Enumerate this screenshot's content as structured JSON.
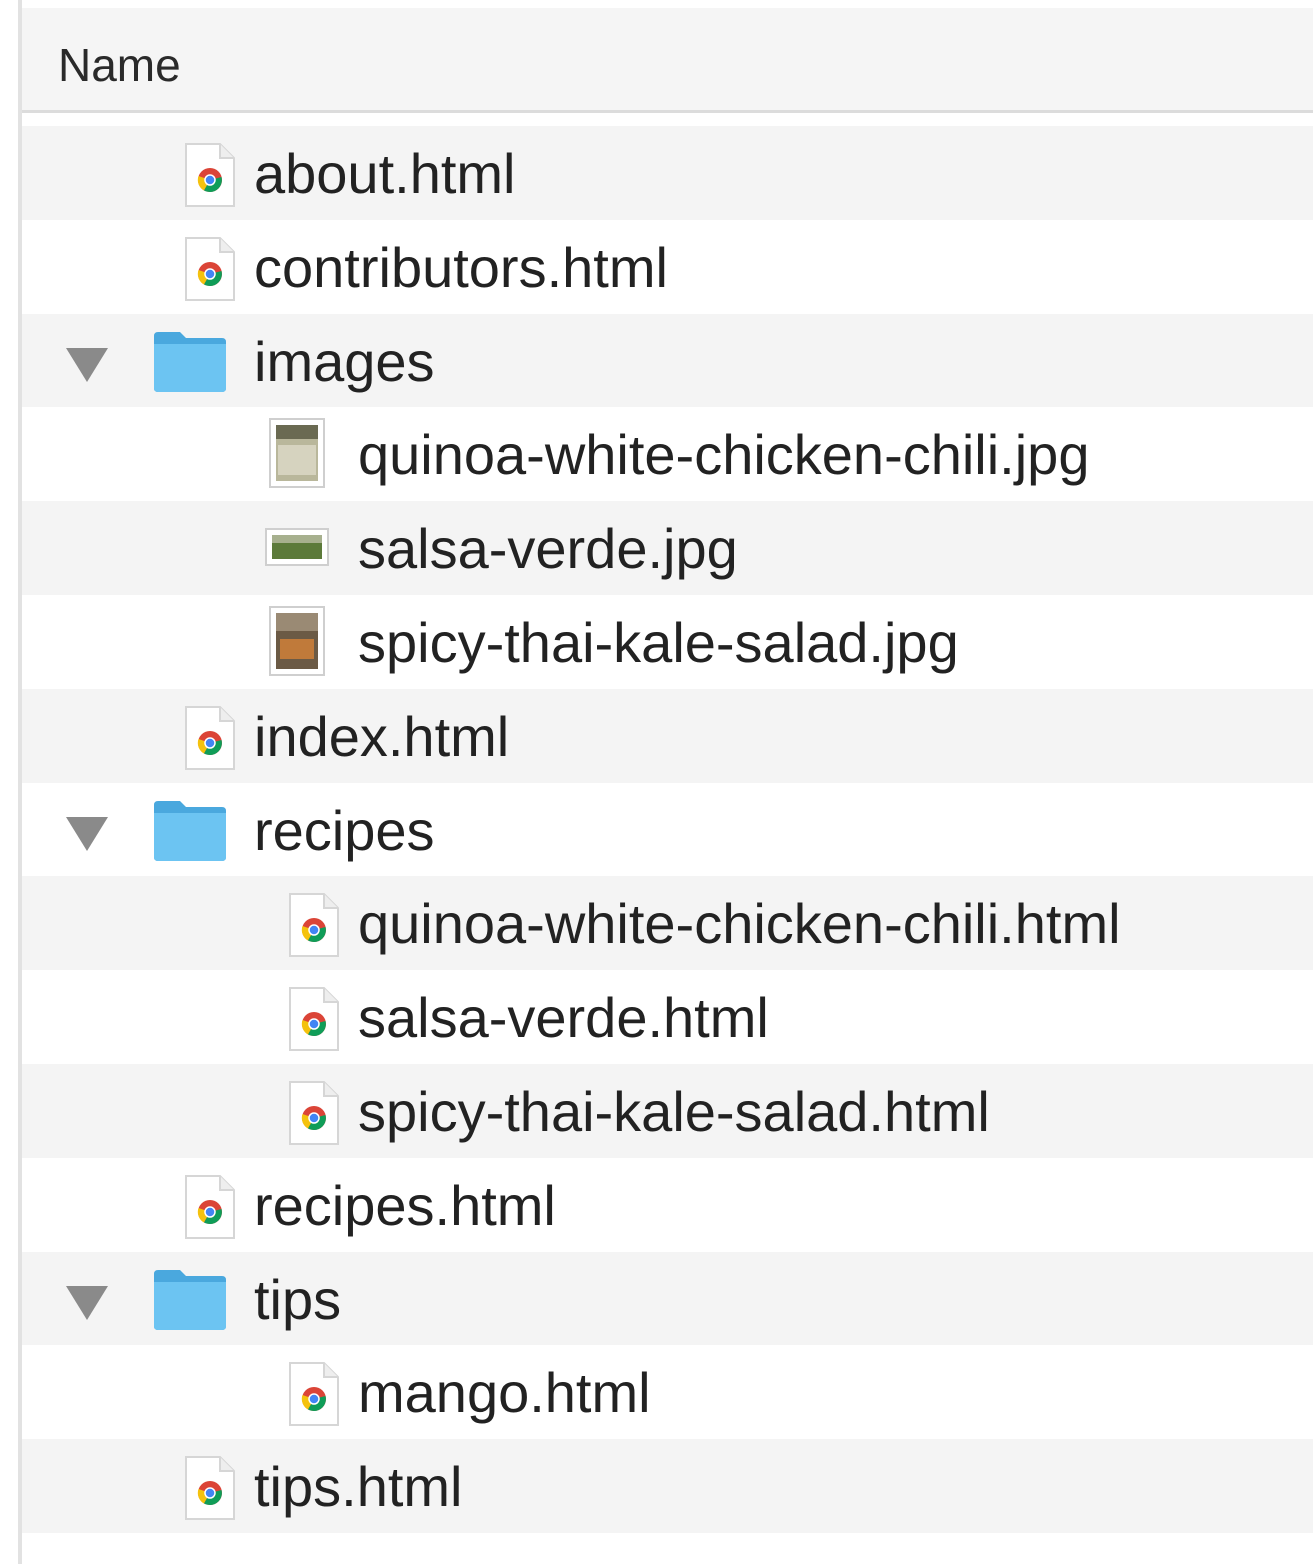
{
  "header": {
    "name_label": "Name"
  },
  "rows": [
    {
      "label": "about.html",
      "kind": "html",
      "level": 1
    },
    {
      "label": "contributors.html",
      "kind": "html",
      "level": 1
    },
    {
      "label": "images",
      "kind": "folder",
      "level": 1,
      "expanded": true
    },
    {
      "label": "quinoa-white-chicken-chili.jpg",
      "kind": "image",
      "level": 2,
      "thumb": "tall"
    },
    {
      "label": "salsa-verde.jpg",
      "kind": "image",
      "level": 2,
      "thumb": "wide"
    },
    {
      "label": "spicy-thai-kale-salad.jpg",
      "kind": "image",
      "level": 2,
      "thumb": "tall2"
    },
    {
      "label": "index.html",
      "kind": "html",
      "level": 1
    },
    {
      "label": "recipes",
      "kind": "folder",
      "level": 1,
      "expanded": true
    },
    {
      "label": "quinoa-white-chicken-chili.html",
      "kind": "html",
      "level": 2
    },
    {
      "label": "salsa-verde.html",
      "kind": "html",
      "level": 2
    },
    {
      "label": "spicy-thai-kale-salad.html",
      "kind": "html",
      "level": 2
    },
    {
      "label": "recipes.html",
      "kind": "html",
      "level": 1
    },
    {
      "label": "tips",
      "kind": "folder",
      "level": 1,
      "expanded": true
    },
    {
      "label": "mango.html",
      "kind": "html",
      "level": 2
    },
    {
      "label": "tips.html",
      "kind": "html",
      "level": 1
    }
  ],
  "colors": {
    "folder": "#5bb8ec",
    "disclosure": "#8a8a8a",
    "row_alt": "#f4f4f4"
  }
}
